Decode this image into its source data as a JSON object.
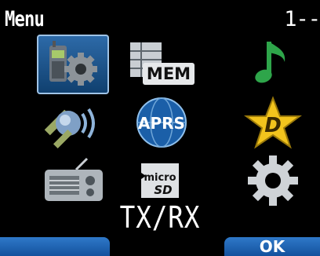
{
  "header": {
    "title": "Menu",
    "page_indicator": "1--"
  },
  "menu_items": [
    {
      "name": "radio-settings",
      "icon": "radio-gear-icon",
      "selected": true
    },
    {
      "name": "memory",
      "icon": "memory-table-icon",
      "badge": "MEM"
    },
    {
      "name": "audio",
      "icon": "music-note-icon"
    },
    {
      "name": "satellite",
      "icon": "satellite-icon"
    },
    {
      "name": "aprs",
      "icon": "aprs-globe-icon",
      "badge": "APRS"
    },
    {
      "name": "dstar",
      "icon": "dstar-icon",
      "badge": "D"
    },
    {
      "name": "radio",
      "icon": "radio-receiver-icon"
    },
    {
      "name": "microsd",
      "icon": "microsd-card-icon",
      "badge_top": "micro",
      "badge_bottom": "SD"
    },
    {
      "name": "configuration",
      "icon": "gear-icon"
    }
  ],
  "selected_label": "TX/RX",
  "softkeys": {
    "left": "",
    "right": "OK"
  },
  "colors": {
    "selection": "#1f5a96",
    "softkey": "#1d63b3",
    "accent_green": "#2e9e3e",
    "star_yellow": "#f2c41d"
  }
}
